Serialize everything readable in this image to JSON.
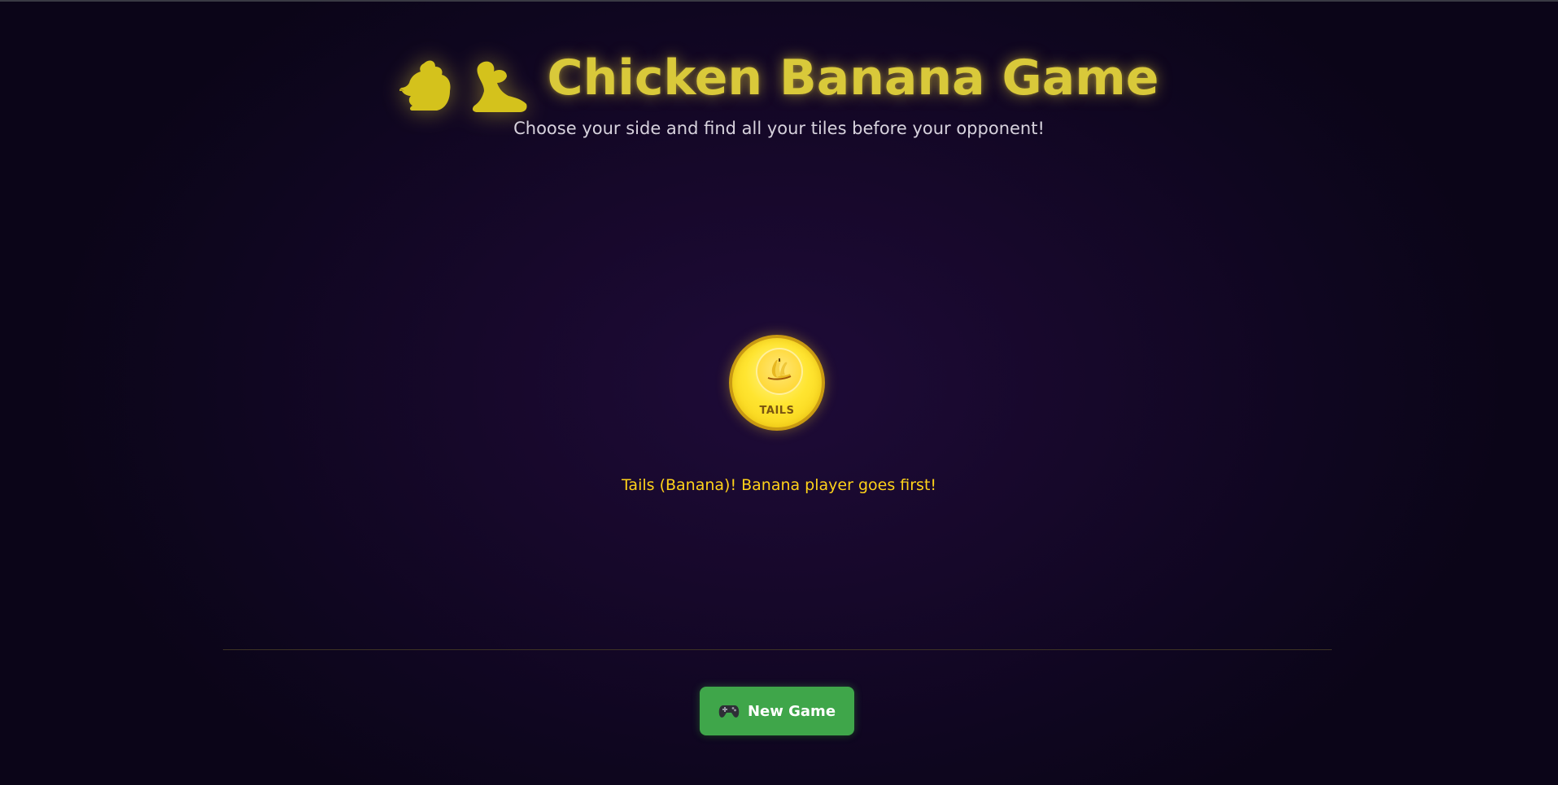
{
  "header": {
    "title": "Chicken Banana Game",
    "title_icons": [
      "chicken-icon",
      "banana-icon"
    ],
    "subtitle": "Choose your side and find all your tiles before your opponent!"
  },
  "coin": {
    "face": "TAILS",
    "icon": "banana-icon"
  },
  "result": {
    "message": "Tails (Banana)! Banana player goes first!"
  },
  "actions": {
    "new_game_label": "New Game",
    "new_game_icon": "gamepad-icon"
  },
  "colors": {
    "accent_gold": "#d9c93a",
    "result_text": "#ffd21a",
    "button_green": "#3fa64a",
    "background": "#17082b"
  }
}
